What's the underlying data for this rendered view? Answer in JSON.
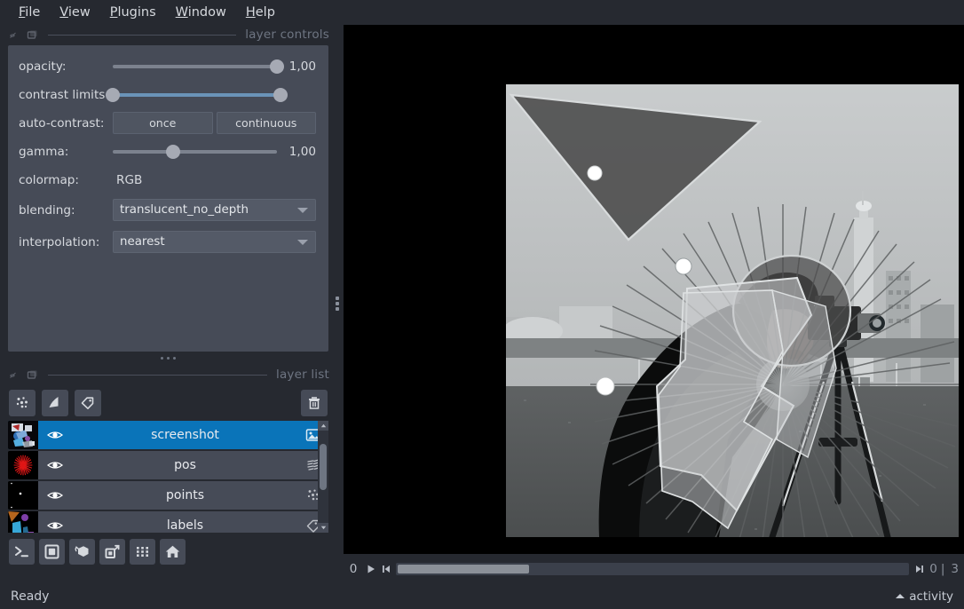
{
  "menu": {
    "items": [
      {
        "label": "File",
        "mnemonic": "F"
      },
      {
        "label": "View",
        "mnemonic": "V"
      },
      {
        "label": "Plugins",
        "mnemonic": "P"
      },
      {
        "label": "Window",
        "mnemonic": "W"
      },
      {
        "label": "Help",
        "mnemonic": "H"
      }
    ]
  },
  "layer_controls": {
    "dock_title": "layer controls",
    "opacity": {
      "label": "opacity:",
      "value": "1,00",
      "handle_pct": 100
    },
    "contrast_limits": {
      "label": "contrast limits:",
      "low_pct": 0,
      "high_pct": 100
    },
    "auto_contrast": {
      "label": "auto-contrast:",
      "once": "once",
      "continuous": "continuous"
    },
    "gamma": {
      "label": "gamma:",
      "value": "1,00",
      "handle_pct": 37
    },
    "colormap": {
      "label": "colormap:",
      "value": "RGB"
    },
    "blending": {
      "label": "blending:",
      "value": "translucent_no_depth"
    },
    "interpolation": {
      "label": "interpolation:",
      "value": "nearest"
    }
  },
  "layer_list": {
    "dock_title": "layer list",
    "add_buttons": [
      {
        "name": "points",
        "icon": "points-icon"
      },
      {
        "name": "shapes",
        "icon": "shapes-icon"
      },
      {
        "name": "labels",
        "icon": "labels-icon"
      }
    ],
    "delete_button": {
      "icon": "trash-icon"
    },
    "layers": [
      {
        "name": "screenshot",
        "type": "image",
        "selected": true,
        "visible": true
      },
      {
        "name": "pos",
        "type": "vectors",
        "selected": false,
        "visible": true
      },
      {
        "name": "points",
        "type": "points",
        "selected": false,
        "visible": true
      },
      {
        "name": "labels",
        "type": "labels",
        "selected": false,
        "visible": true
      }
    ]
  },
  "viewer_buttons": [
    {
      "name": "console",
      "icon": "console-icon"
    },
    {
      "name": "ndisplay",
      "icon": "square-2d-icon"
    },
    {
      "name": "roll-dims",
      "icon": "cube-roll-icon"
    },
    {
      "name": "transpose-dims",
      "icon": "transpose-icon"
    },
    {
      "name": "grid-view",
      "icon": "grid-icon"
    },
    {
      "name": "reset-view",
      "icon": "home-icon"
    }
  ],
  "dims": {
    "current_index": "0",
    "play_label": "play",
    "min_label": "0",
    "max_label": "3",
    "separator": "|",
    "thumb_pct": 17
  },
  "status": {
    "message": "Ready",
    "activity_label": "activity"
  },
  "colors": {
    "window_bg": "#262930",
    "panel_bg": "#464b57",
    "selection_blue": "#0a74b9",
    "text": "#d6d9de",
    "muted_text": "#6e7582",
    "slider_track": "#7c828e",
    "slider_handle": "#a6aab4",
    "contrast_fill": "#6a93b8"
  }
}
